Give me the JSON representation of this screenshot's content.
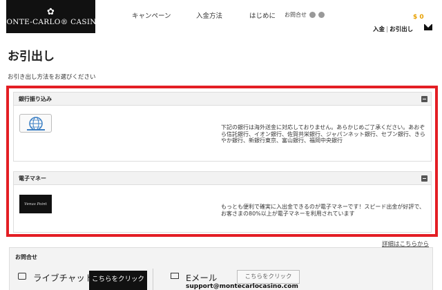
{
  "header": {
    "logo": {
      "emblem": "✿",
      "text": "MONTE-CARLO® CASINO"
    },
    "nav": [
      {
        "label": "キャンペーン"
      },
      {
        "label": "入金方法"
      },
      {
        "label": "はじめに"
      }
    ],
    "contact_label": "お問合せ",
    "balance": "$ 0",
    "deposit_label": "入金",
    "withdraw_label": "お引出し"
  },
  "page": {
    "title": "お引出し",
    "subtitle": "お引き出し方法をお選びください"
  },
  "methods": [
    {
      "name": "銀行振り込み",
      "description": "下記の銀行は海外送金に対応しておりません。あらかじめご了承ください。あおぞら信託銀行、イオン銀行、佐賀共栄銀行、ジャパンネット銀行、セブン銀行、きらやか銀行、新銀行東京、富山銀行、福岡中央銀行"
    },
    {
      "name": "電子マネー",
      "logo_text": "Venus Point",
      "description": "もっとも便利で確実に入出金できるのが電子マネーです！スピード出金が好評で、お客さまの80%以上が電子マネーを利用されています"
    }
  ],
  "details_link": "詳細はこちらから",
  "contact": {
    "title": "お問合せ",
    "chat_label": "ライブチャット",
    "chat_button": "こちらをクリック",
    "email_label": "Eメール",
    "email_button": "こちらをクリック",
    "email_address": "support@montecarlocasino.com"
  },
  "colors": {
    "highlight": "#e31e24",
    "balance": "#e8a000",
    "logo_bg": "#111111"
  }
}
